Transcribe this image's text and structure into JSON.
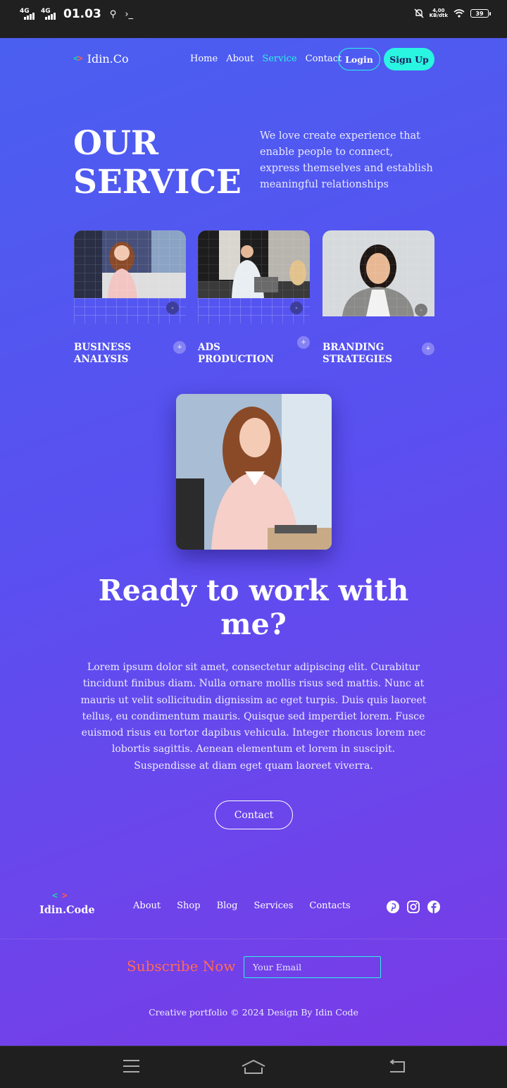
{
  "status_bar": {
    "sim1": "4G",
    "sim2": "4G",
    "time": "01.03",
    "speed_value": "4,00",
    "speed_unit": "KB/dtk",
    "battery": "39"
  },
  "nav": {
    "logo": "Idin.Co",
    "links": [
      "Home",
      "About",
      "Service",
      "Contact"
    ],
    "active_link": "Service",
    "login": "Login",
    "signup": "Sign Up"
  },
  "hero": {
    "title_line1": "OUR",
    "title_line2": "SERVICE",
    "description": "We love create experience that enable people to connect, express themselves and establish meaningful relationships"
  },
  "services": [
    {
      "label": "BUSINESS ANALYSIS"
    },
    {
      "label": "ADS PRODUCTION"
    },
    {
      "label": "BRANDING STRATEGIES"
    }
  ],
  "cta": {
    "title": "Ready to work with me?",
    "body": "Lorem ipsum dolor sit amet, consectetur adipiscing elit. Curabitur tincidunt finibus diam. Nulla ornare mollis risus sed mattis. Nunc at mauris ut velit sollicitudin dignissim ac eget turpis. Duis quis laoreet tellus, eu condimentum mauris. Quisque sed imperdiet lorem. Fusce euismod risus eu tortor dapibus vehicula. Integer rhoncus lorem nec lobortis sagittis. Aenean elementum et lorem in suscipit. Suspendisse at diam eget quam laoreet viverra.",
    "button": "Contact"
  },
  "footer": {
    "logo": "Idin.Code",
    "links": [
      "About",
      "Shop",
      "Blog",
      "Services",
      "Contacts"
    ],
    "social_icons": [
      "pinterest-icon",
      "instagram-icon",
      "facebook-icon"
    ],
    "subscribe": "Subscribe Now",
    "email_placeholder": "Your Email",
    "copyright": "Creative portfolio © 2024 Design By Idin Code"
  },
  "colors": {
    "accent": "#2af5e0",
    "subscribe": "#ff6b55",
    "gradient_start": "#4a5ff0",
    "gradient_end": "#7a3ae6"
  }
}
